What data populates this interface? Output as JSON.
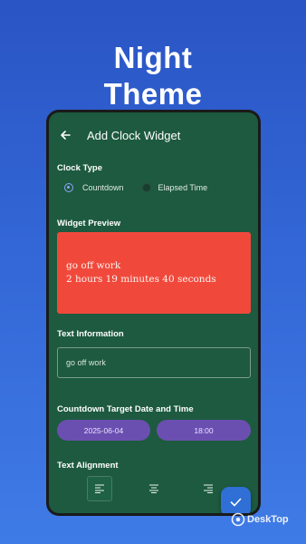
{
  "promo": {
    "line1": "Night",
    "line2": "Theme"
  },
  "appbar": {
    "title": "Add Clock Widget"
  },
  "clock_type": {
    "label": "Clock Type",
    "options": [
      {
        "label": "Countdown",
        "selected": true
      },
      {
        "label": "Elapsed Time",
        "selected": false
      }
    ]
  },
  "preview": {
    "label": "Widget Preview",
    "line1": "go off work",
    "line2": "2 hours 19 minutes 40 seconds",
    "background": "#f0493c"
  },
  "text_info": {
    "label": "Text Information",
    "value": "go off work"
  },
  "target": {
    "label": "Countdown Target Date and Time",
    "date": "2025-06-04",
    "time": "18:00"
  },
  "alignment": {
    "label": "Text Alignment",
    "selected": "left"
  },
  "watermark": {
    "text": "DeskTop"
  },
  "colors": {
    "screen_bg": "#1d5a3f",
    "pill": "#6b4fb0",
    "fab": "#2f6fd6",
    "accent": "#8fa4ff"
  }
}
